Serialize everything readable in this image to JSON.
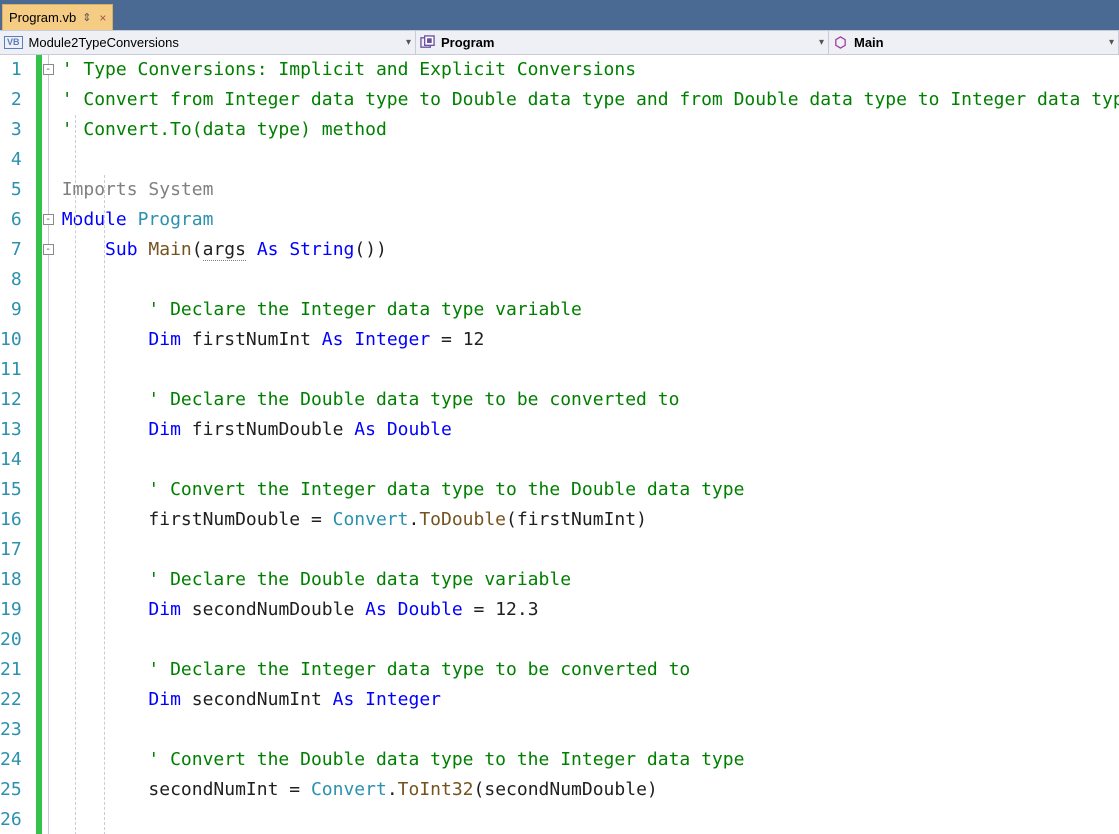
{
  "tab": {
    "filename": "Program.vb",
    "pin_glyph": "⇕",
    "close_glyph": "×"
  },
  "nav": {
    "project": "Module2TypeConversions",
    "class": "Program",
    "member": "Main"
  },
  "line_numbers": [
    1,
    2,
    3,
    4,
    5,
    6,
    7,
    8,
    9,
    10,
    11,
    12,
    13,
    14,
    15,
    16,
    17,
    18,
    19,
    20,
    21,
    22,
    23,
    24,
    25,
    26
  ],
  "fold_boxes": [
    {
      "row": 1,
      "glyph": "-"
    },
    {
      "row": 6,
      "glyph": "-"
    },
    {
      "row": 7,
      "glyph": "-"
    }
  ],
  "code_lines": [
    {
      "n": 1,
      "indent": 0,
      "spans": [
        {
          "t": "' Type Conversions: Implicit and Explicit Conversions",
          "c": "comment"
        }
      ]
    },
    {
      "n": 2,
      "indent": 0,
      "spans": [
        {
          "t": "' Convert from Integer data type to Double data type and from Double data type to Integer data type",
          "c": "comment"
        }
      ]
    },
    {
      "n": 3,
      "indent": 0,
      "spans": [
        {
          "t": "' Convert.To(data type) method",
          "c": "comment"
        }
      ]
    },
    {
      "n": 4,
      "indent": 0,
      "spans": []
    },
    {
      "n": 5,
      "indent": 0,
      "spans": [
        {
          "t": "Imports ",
          "c": "gray"
        },
        {
          "t": "System",
          "c": "gray"
        }
      ]
    },
    {
      "n": 6,
      "indent": 0,
      "spans": [
        {
          "t": "Module",
          "c": "keyword"
        },
        {
          "t": " ",
          "c": "ident"
        },
        {
          "t": "Program",
          "c": "type"
        }
      ]
    },
    {
      "n": 7,
      "indent": 1,
      "spans": [
        {
          "t": "Sub",
          "c": "keyword"
        },
        {
          "t": " ",
          "c": "ident"
        },
        {
          "t": "Main",
          "c": "brown"
        },
        {
          "t": "(",
          "c": "ident"
        },
        {
          "t": "args",
          "c": "ident",
          "u": true
        },
        {
          "t": " ",
          "c": "ident"
        },
        {
          "t": "As",
          "c": "keyword"
        },
        {
          "t": " ",
          "c": "ident"
        },
        {
          "t": "String",
          "c": "keyword"
        },
        {
          "t": "())",
          "c": "ident"
        }
      ]
    },
    {
      "n": 8,
      "indent": 1,
      "spans": []
    },
    {
      "n": 9,
      "indent": 2,
      "spans": [
        {
          "t": "' Declare the Integer data type variable",
          "c": "comment"
        }
      ]
    },
    {
      "n": 10,
      "indent": 2,
      "spans": [
        {
          "t": "Dim",
          "c": "keyword"
        },
        {
          "t": " firstNumInt ",
          "c": "ident"
        },
        {
          "t": "As",
          "c": "keyword"
        },
        {
          "t": " ",
          "c": "ident"
        },
        {
          "t": "Integer",
          "c": "keyword"
        },
        {
          "t": " = 12",
          "c": "ident"
        }
      ]
    },
    {
      "n": 11,
      "indent": 2,
      "spans": []
    },
    {
      "n": 12,
      "indent": 2,
      "spans": [
        {
          "t": "' Declare the Double data type to be converted to",
          "c": "comment"
        }
      ]
    },
    {
      "n": 13,
      "indent": 2,
      "spans": [
        {
          "t": "Dim",
          "c": "keyword"
        },
        {
          "t": " firstNumDouble ",
          "c": "ident"
        },
        {
          "t": "As",
          "c": "keyword"
        },
        {
          "t": " ",
          "c": "ident"
        },
        {
          "t": "Double",
          "c": "keyword"
        }
      ]
    },
    {
      "n": 14,
      "indent": 2,
      "spans": []
    },
    {
      "n": 15,
      "indent": 2,
      "spans": [
        {
          "t": "' Convert the Integer data type to the Double data type",
          "c": "comment"
        }
      ]
    },
    {
      "n": 16,
      "indent": 2,
      "spans": [
        {
          "t": "firstNumDouble = ",
          "c": "ident"
        },
        {
          "t": "Convert",
          "c": "type"
        },
        {
          "t": ".",
          "c": "ident"
        },
        {
          "t": "ToDouble",
          "c": "brown"
        },
        {
          "t": "(firstNumInt)",
          "c": "ident"
        }
      ]
    },
    {
      "n": 17,
      "indent": 2,
      "spans": []
    },
    {
      "n": 18,
      "indent": 2,
      "spans": [
        {
          "t": "' Declare the Double data type variable",
          "c": "comment"
        }
      ]
    },
    {
      "n": 19,
      "indent": 2,
      "spans": [
        {
          "t": "Dim",
          "c": "keyword"
        },
        {
          "t": " secondNumDouble ",
          "c": "ident"
        },
        {
          "t": "As",
          "c": "keyword"
        },
        {
          "t": " ",
          "c": "ident"
        },
        {
          "t": "Double",
          "c": "keyword"
        },
        {
          "t": " = 12.3",
          "c": "ident"
        }
      ]
    },
    {
      "n": 20,
      "indent": 2,
      "spans": []
    },
    {
      "n": 21,
      "indent": 2,
      "spans": [
        {
          "t": "' Declare the Integer data type to be converted to",
          "c": "comment"
        }
      ]
    },
    {
      "n": 22,
      "indent": 2,
      "spans": [
        {
          "t": "Dim",
          "c": "keyword"
        },
        {
          "t": " secondNumInt ",
          "c": "ident"
        },
        {
          "t": "As",
          "c": "keyword"
        },
        {
          "t": " ",
          "c": "ident"
        },
        {
          "t": "Integer",
          "c": "keyword"
        }
      ]
    },
    {
      "n": 23,
      "indent": 2,
      "spans": []
    },
    {
      "n": 24,
      "indent": 2,
      "spans": [
        {
          "t": "' Convert the Double data type to the Integer data type",
          "c": "comment"
        }
      ]
    },
    {
      "n": 25,
      "indent": 2,
      "spans": [
        {
          "t": "secondNumInt = ",
          "c": "ident"
        },
        {
          "t": "Convert",
          "c": "type"
        },
        {
          "t": ".",
          "c": "ident"
        },
        {
          "t": "ToInt32",
          "c": "brown"
        },
        {
          "t": "(secondNumDouble)",
          "c": "ident"
        }
      ]
    },
    {
      "n": 26,
      "indent": 2,
      "spans": []
    }
  ]
}
